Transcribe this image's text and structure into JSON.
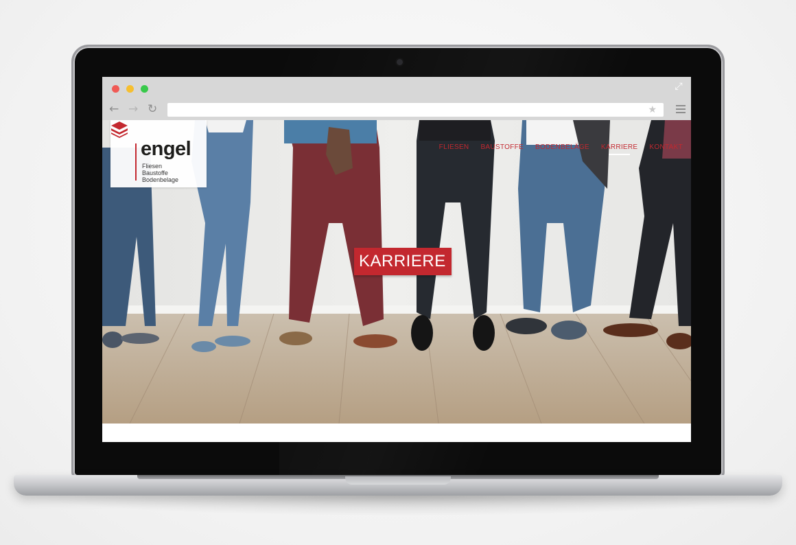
{
  "browser": {
    "address_value": "",
    "icons": {
      "back": "back-arrow-icon",
      "forward": "forward-arrow-icon",
      "reload": "reload-icon",
      "bookmark": "star-icon",
      "menu": "hamburger-menu-icon",
      "fullscreen": "expand-icon"
    }
  },
  "site": {
    "logo": {
      "wordmark": "engel",
      "tagline_lines": [
        "Fliesen",
        "Baustoffe",
        "Bodenbelage"
      ]
    },
    "nav": [
      {
        "label": "FLIESEN",
        "active": false
      },
      {
        "label": "BAUSTOFFE",
        "active": false
      },
      {
        "label": "BODENBELÄGE",
        "active": false
      },
      {
        "label": "KARRIERE",
        "active": true
      },
      {
        "label": "KONTAKT",
        "active": false
      }
    ],
    "hero_title": "KARRIERE"
  },
  "colors": {
    "brand_red": "#c3282f",
    "chrome_gray": "#d7d7d7"
  }
}
